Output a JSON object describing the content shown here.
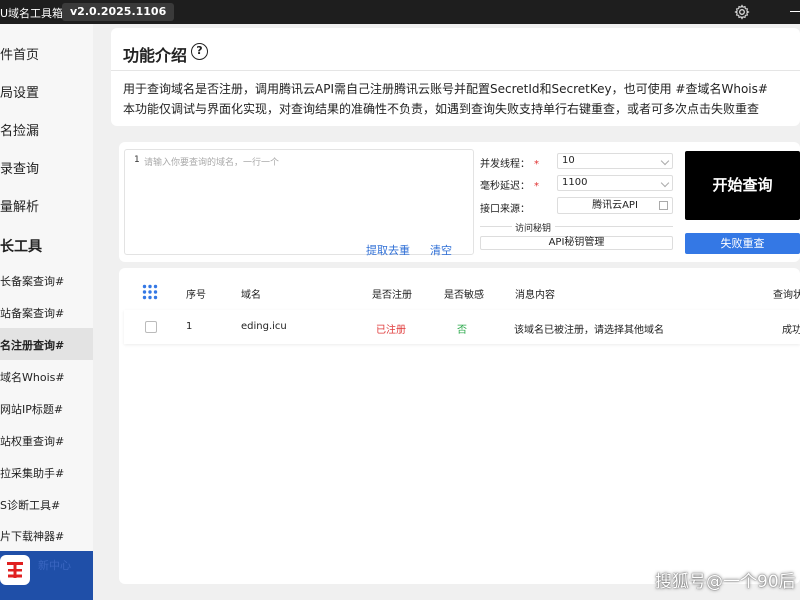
{
  "titlebar": {
    "app_title": "U域名工具箱",
    "version": "v2.0.2025.1106",
    "icons": [
      "gear-icon",
      "minimize-icon"
    ]
  },
  "sidebar": {
    "items": [
      {
        "label": "件首页"
      },
      {
        "label": "局设置"
      },
      {
        "label": "名捡漏"
      },
      {
        "label": "录查询"
      },
      {
        "label": "量解析"
      },
      {
        "label": "长工具"
      },
      {
        "label": "长备案查询#"
      },
      {
        "label": "站备案查询#"
      },
      {
        "label": "名注册查询#"
      },
      {
        "label": "域名Whois#"
      },
      {
        "label": "网站IP标题#"
      },
      {
        "label": "站权重查询#"
      },
      {
        "label": "拉采集助手#"
      },
      {
        "label": "S诊断工具#"
      },
      {
        "label": "片下载神器#"
      }
    ],
    "logo_deco": "新中心"
  },
  "intro": {
    "title": "功能介绍",
    "line1": "用于查询域名是否注册，调用腾讯云API需自己注册腾讯云账号并配置SecretId和SecretKey，也可使用 #查域名Whois#",
    "line2": "本功能仅调试与界面化实现，对查询结果的准确性不负责，如遇到查询失败支持单行右键重查，或者可多次点击失败重查"
  },
  "query": {
    "line_number": "1",
    "domain_placeholder": "请输入你要查询的域名，一行一个",
    "dedupe_label": "提取去重",
    "clear_label": "清空",
    "threads_label": "并发线程：",
    "threads_value": "10",
    "delay_label": "毫秒延迟：",
    "delay_value": "1100",
    "required_mark": "*",
    "source_label": "接口来源：",
    "source_value": "腾讯云API",
    "secret_label": "访问秘钥",
    "secret_button": "API秘钥管理",
    "start_button": "开始查询",
    "retry_button": "失败重查"
  },
  "table": {
    "columns": [
      "序号",
      "域名",
      "是否注册",
      "是否敏感",
      "消息内容",
      "查询状"
    ],
    "rows": [
      {
        "index": "1",
        "domain": "eding.icu",
        "registered": "已注册",
        "sensitive": "否",
        "message": "该域名已被注册，请选择其他域名",
        "status": "成功"
      }
    ],
    "colors": {
      "registered": "#e03a3a",
      "sensitive": "#2aa84a"
    }
  },
  "watermark": "搜狐号@一个90后"
}
